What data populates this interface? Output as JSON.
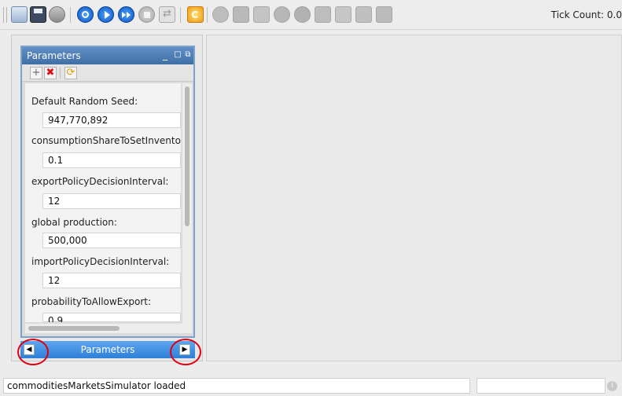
{
  "toolbar": {
    "tick_count_label": "Tick Count: 0.0",
    "icons": [
      "new-file-icon",
      "save-icon",
      "database-icon",
      "power-icon",
      "play-icon",
      "fast-forward-icon",
      "stop-icon",
      "reset-icon",
      "refresh-icon",
      "chart-icon",
      "dataset-icon",
      "table-icon",
      "sphere-icon",
      "person-icon",
      "map-icon",
      "monitor-icon",
      "image-icon",
      "grid-icon"
    ]
  },
  "params_panel": {
    "title": "Parameters",
    "controls": {
      "minimize": "_",
      "maximize": "□",
      "restore": "⧉"
    },
    "tools": {
      "add": "+",
      "remove": "✖",
      "refresh": "⟳"
    },
    "items": [
      {
        "label": "Default Random Seed:",
        "value": "947,770,892"
      },
      {
        "label": "consumptionShareToSetInventory",
        "value": "0.1"
      },
      {
        "label": "exportPolicyDecisionInterval:",
        "value": "12"
      },
      {
        "label": "global production:",
        "value": "500,000"
      },
      {
        "label": "importPolicyDecisionInterval:",
        "value": "12"
      },
      {
        "label": "probabilityToAllowExport:",
        "value": "0.9"
      }
    ]
  },
  "tabbar": {
    "label": "Parameters",
    "prev_arrow": "◀",
    "next_arrow": "▶"
  },
  "status": {
    "message": "commoditiesMarketsSimulator loaded",
    "info_glyph": "i"
  },
  "colors": {
    "panel_title_blue": "#3f6fa6",
    "tab_blue": "#2f7fd8",
    "highlight_red": "#e0000f"
  }
}
